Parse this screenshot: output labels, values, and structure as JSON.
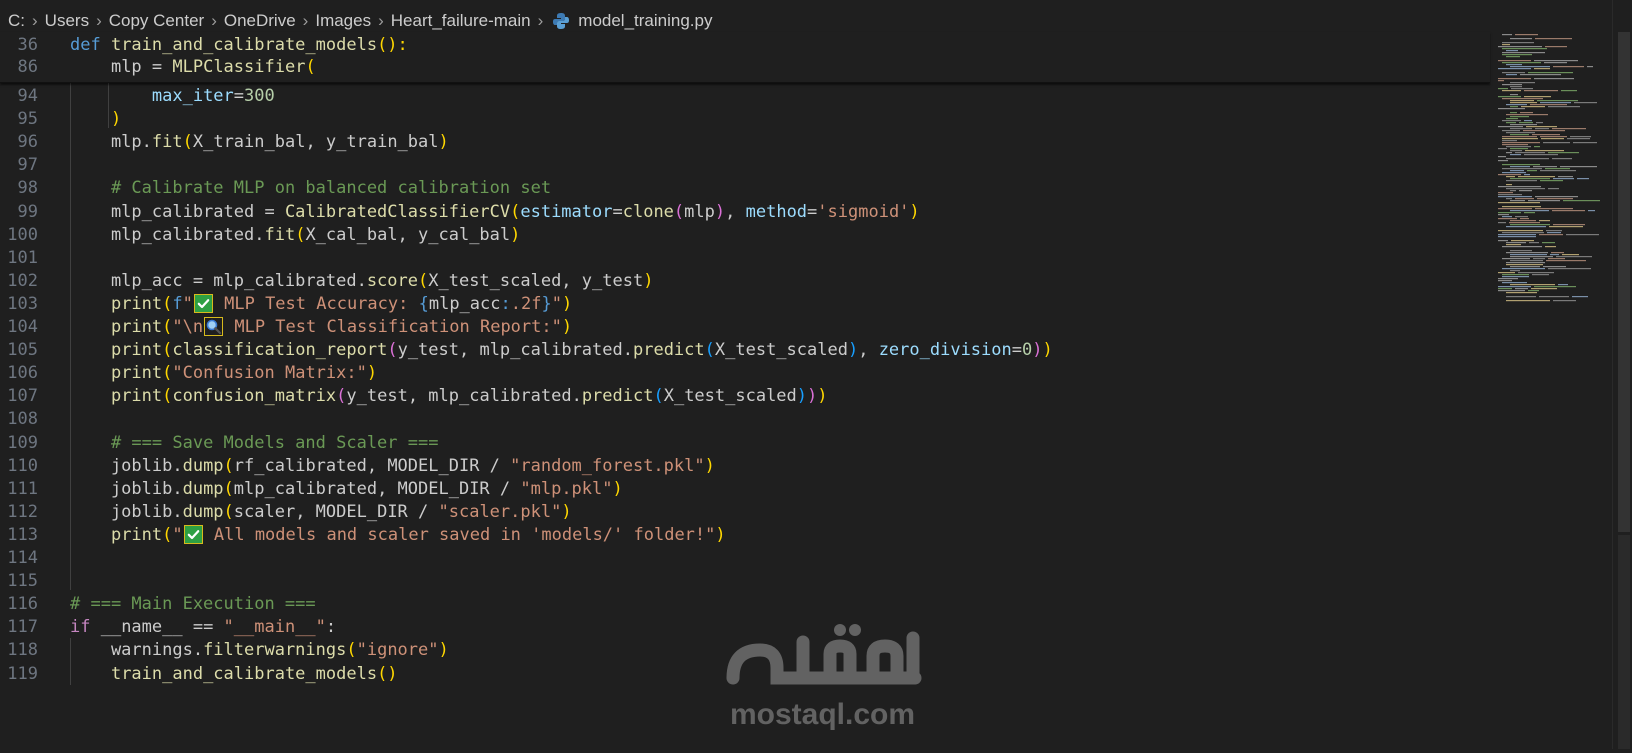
{
  "breadcrumb": [
    "C:",
    "Users",
    "Copy Center",
    "OneDrive",
    "Images",
    "Heart_failure-main",
    "model_training.py"
  ],
  "icons": {
    "separator": "chevron-right-icon",
    "file": "python-file-icon",
    "emoji_check": "white-heavy-check-mark-emoji",
    "emoji_magnifier": "magnifying-glass-emoji"
  },
  "colors": {
    "background": "#1f1f1f",
    "keyword": "#569cd6",
    "control": "#c586c0",
    "function": "#dcdcaa",
    "string": "#ce9178",
    "number": "#b5cea8",
    "comment": "#6a9955",
    "parameter": "#9cdcfe",
    "line_number": "#6e7681",
    "bracket_1": "#ffd700",
    "bracket_2": "#da70d6",
    "bracket_3": "#179fff"
  },
  "sticky_lines": [
    {
      "number": "36",
      "tokens": [
        [
          "kw",
          "def "
        ],
        [
          "fn",
          "train_and_calibrate_models"
        ],
        [
          "b1",
          "():"
        ]
      ]
    },
    {
      "number": "86",
      "tokens": [
        [
          "t",
          "    "
        ],
        [
          "t",
          "mlp = "
        ],
        [
          "fn",
          "MLPClassifier"
        ],
        [
          "b1",
          "("
        ]
      ]
    }
  ],
  "code_lines": [
    {
      "number": "94",
      "tokens": [
        [
          "t",
          "        "
        ],
        [
          "prm",
          "max_iter"
        ],
        [
          "t",
          "="
        ],
        [
          "num",
          "300"
        ]
      ]
    },
    {
      "number": "95",
      "tokens": [
        [
          "t",
          "    "
        ],
        [
          "b1",
          ")"
        ]
      ]
    },
    {
      "number": "96",
      "tokens": [
        [
          "t",
          "    mlp."
        ],
        [
          "fn",
          "fit"
        ],
        [
          "b1",
          "("
        ],
        [
          "t",
          "X_train_bal, y_train_bal"
        ],
        [
          "b1",
          ")"
        ]
      ]
    },
    {
      "number": "97",
      "tokens": []
    },
    {
      "number": "98",
      "tokens": [
        [
          "t",
          "    "
        ],
        [
          "cmt",
          "# Calibrate MLP on balanced calibration set"
        ]
      ]
    },
    {
      "number": "99",
      "tokens": [
        [
          "t",
          "    mlp_calibrated = "
        ],
        [
          "fn",
          "CalibratedClassifierCV"
        ],
        [
          "b1",
          "("
        ],
        [
          "prm",
          "estimator"
        ],
        [
          "t",
          "="
        ],
        [
          "fn",
          "clone"
        ],
        [
          "b2",
          "("
        ],
        [
          "t",
          "mlp"
        ],
        [
          "b2",
          ")"
        ],
        [
          "t",
          ", "
        ],
        [
          "prm",
          "method"
        ],
        [
          "t",
          "="
        ],
        [
          "str",
          "'sigmoid'"
        ],
        [
          "b1",
          ")"
        ]
      ]
    },
    {
      "number": "100",
      "tokens": [
        [
          "t",
          "    mlp_calibrated."
        ],
        [
          "fn",
          "fit"
        ],
        [
          "b1",
          "("
        ],
        [
          "t",
          "X_cal_bal, y_cal_bal"
        ],
        [
          "b1",
          ")"
        ]
      ]
    },
    {
      "number": "101",
      "tokens": []
    },
    {
      "number": "102",
      "tokens": [
        [
          "t",
          "    mlp_acc = mlp_calibrated."
        ],
        [
          "fn",
          "score"
        ],
        [
          "b1",
          "("
        ],
        [
          "t",
          "X_test_scaled, y_test"
        ],
        [
          "b1",
          ")"
        ]
      ]
    },
    {
      "number": "103",
      "tokens": [
        [
          "t",
          "    "
        ],
        [
          "fn",
          "print"
        ],
        [
          "b1",
          "("
        ],
        [
          "kw",
          "f"
        ],
        [
          "str",
          "\""
        ],
        [
          "emoji",
          "✅"
        ],
        [
          "str",
          " MLP Test Accuracy: "
        ],
        [
          "kw",
          "{"
        ],
        [
          "t",
          "mlp_acc"
        ],
        [
          "kw",
          ":"
        ],
        [
          "str",
          ".2f"
        ],
        [
          "kw",
          "}"
        ],
        [
          "str",
          "\""
        ],
        [
          "b1",
          ")"
        ]
      ]
    },
    {
      "number": "104",
      "tokens": [
        [
          "t",
          "    "
        ],
        [
          "fn",
          "print"
        ],
        [
          "b1",
          "("
        ],
        [
          "str",
          "\"\\n"
        ],
        [
          "emoji",
          "🔍"
        ],
        [
          "str",
          " MLP Test Classification Report:\""
        ],
        [
          "b1",
          ")"
        ]
      ]
    },
    {
      "number": "105",
      "tokens": [
        [
          "t",
          "    "
        ],
        [
          "fn",
          "print"
        ],
        [
          "b1",
          "("
        ],
        [
          "fn",
          "classification_report"
        ],
        [
          "b2",
          "("
        ],
        [
          "t",
          "y_test, mlp_calibrated."
        ],
        [
          "fn",
          "predict"
        ],
        [
          "b3",
          "("
        ],
        [
          "t",
          "X_test_scaled"
        ],
        [
          "b3",
          ")"
        ],
        [
          "t",
          ", "
        ],
        [
          "prm",
          "zero_division"
        ],
        [
          "t",
          "="
        ],
        [
          "num",
          "0"
        ],
        [
          "b2",
          ")"
        ],
        [
          "b1",
          ")"
        ]
      ]
    },
    {
      "number": "106",
      "tokens": [
        [
          "t",
          "    "
        ],
        [
          "fn",
          "print"
        ],
        [
          "b1",
          "("
        ],
        [
          "str",
          "\"Confusion Matrix:\""
        ],
        [
          "b1",
          ")"
        ]
      ]
    },
    {
      "number": "107",
      "tokens": [
        [
          "t",
          "    "
        ],
        [
          "fn",
          "print"
        ],
        [
          "b1",
          "("
        ],
        [
          "fn",
          "confusion_matrix"
        ],
        [
          "b2",
          "("
        ],
        [
          "t",
          "y_test, mlp_calibrated."
        ],
        [
          "fn",
          "predict"
        ],
        [
          "b3",
          "("
        ],
        [
          "t",
          "X_test_scaled"
        ],
        [
          "b3",
          ")"
        ],
        [
          "b2",
          ")"
        ],
        [
          "b1",
          ")"
        ]
      ]
    },
    {
      "number": "108",
      "tokens": []
    },
    {
      "number": "109",
      "tokens": [
        [
          "t",
          "    "
        ],
        [
          "cmt",
          "# === Save Models and Scaler ==="
        ]
      ]
    },
    {
      "number": "110",
      "tokens": [
        [
          "t",
          "    joblib."
        ],
        [
          "fn",
          "dump"
        ],
        [
          "b1",
          "("
        ],
        [
          "t",
          "rf_calibrated, MODEL_DIR / "
        ],
        [
          "str",
          "\"random_forest.pkl\""
        ],
        [
          "b1",
          ")"
        ]
      ]
    },
    {
      "number": "111",
      "tokens": [
        [
          "t",
          "    joblib."
        ],
        [
          "fn",
          "dump"
        ],
        [
          "b1",
          "("
        ],
        [
          "t",
          "mlp_calibrated, MODEL_DIR / "
        ],
        [
          "str",
          "\"mlp.pkl\""
        ],
        [
          "b1",
          ")"
        ]
      ]
    },
    {
      "number": "112",
      "tokens": [
        [
          "t",
          "    joblib."
        ],
        [
          "fn",
          "dump"
        ],
        [
          "b1",
          "("
        ],
        [
          "t",
          "scaler, MODEL_DIR / "
        ],
        [
          "str",
          "\"scaler.pkl\""
        ],
        [
          "b1",
          ")"
        ]
      ]
    },
    {
      "number": "113",
      "tokens": [
        [
          "t",
          "    "
        ],
        [
          "fn",
          "print"
        ],
        [
          "b1",
          "("
        ],
        [
          "str",
          "\""
        ],
        [
          "emoji",
          "✅"
        ],
        [
          "str",
          " All models and scaler saved in 'models/' folder!\""
        ],
        [
          "b1",
          ")"
        ]
      ]
    },
    {
      "number": "114",
      "tokens": []
    },
    {
      "number": "115",
      "tokens": []
    },
    {
      "number": "116",
      "tokens": [
        [
          "cmt",
          "# === Main Execution ==="
        ]
      ]
    },
    {
      "number": "117",
      "tokens": [
        [
          "ctrl",
          "if "
        ],
        [
          "t",
          "__name__ == "
        ],
        [
          "str",
          "\"__main__\""
        ],
        [
          "t",
          ":"
        ]
      ]
    },
    {
      "number": "118",
      "tokens": [
        [
          "t",
          "    warnings."
        ],
        [
          "fn",
          "filterwarnings"
        ],
        [
          "b1",
          "("
        ],
        [
          "str",
          "\"ignore\""
        ],
        [
          "b1",
          ")"
        ]
      ]
    },
    {
      "number": "119",
      "tokens": [
        [
          "t",
          "    "
        ],
        [
          "fn",
          "train_and_calibrate_models"
        ],
        [
          "b1",
          "()"
        ]
      ]
    }
  ],
  "watermark": {
    "arabic": "مستقل",
    "latin": "mostaql.com"
  }
}
